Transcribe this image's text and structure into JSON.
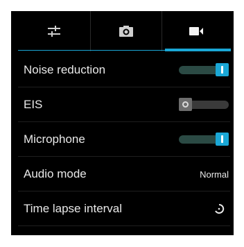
{
  "tabs": [
    {
      "icon": "sliders-icon",
      "active": false
    },
    {
      "icon": "camera-icon",
      "active": false
    },
    {
      "icon": "video-camera-icon",
      "active": true
    }
  ],
  "settings": {
    "noise_reduction": {
      "label": "Noise reduction",
      "enabled": true
    },
    "eis": {
      "label": "EIS",
      "enabled": false
    },
    "microphone": {
      "label": "Microphone",
      "enabled": true
    },
    "audio_mode": {
      "label": "Audio mode",
      "value": "Normal"
    },
    "time_lapse": {
      "label": "Time lapse interval",
      "icon": "timer-icon"
    }
  },
  "colors": {
    "accent": "#1aa7d6",
    "background": "#000000",
    "text": "#e9e9e9"
  }
}
